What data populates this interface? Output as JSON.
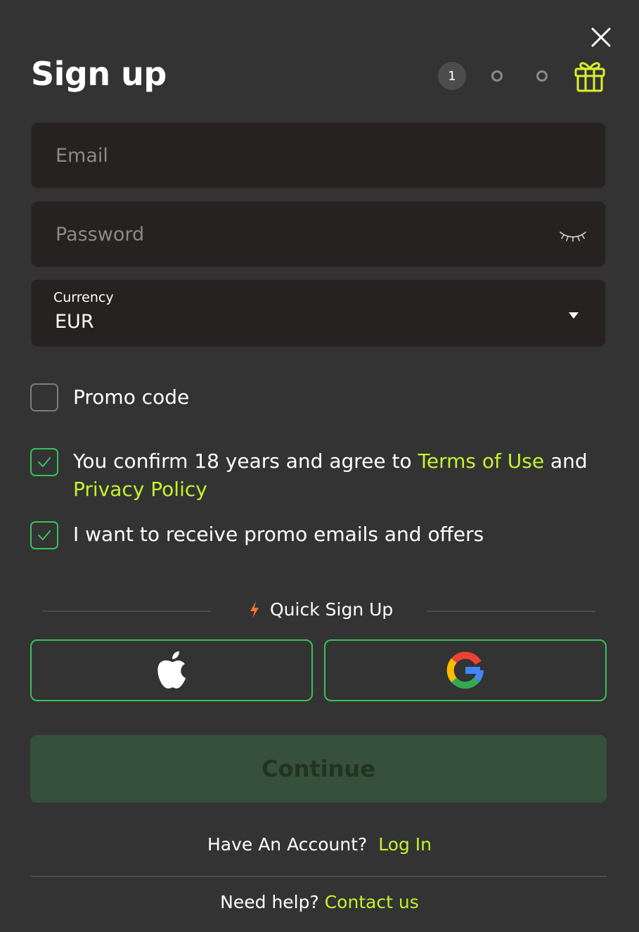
{
  "header": {
    "title": "Sign up",
    "current_step": "1",
    "steps_total": 3
  },
  "form": {
    "email_placeholder": "Email",
    "password_placeholder": "Password",
    "currency_label": "Currency",
    "currency_value": "EUR"
  },
  "checkboxes": {
    "promo_code": {
      "label": "Promo code",
      "checked": false
    },
    "terms": {
      "prefix": "You confirm 18 years and agree to ",
      "terms_link": "Terms of Use",
      "middle": " and ",
      "privacy_link": "Privacy Policy",
      "checked": true
    },
    "promo_emails": {
      "label": "I want to receive promo emails and offers",
      "checked": true
    }
  },
  "quick_signup": {
    "label": "Quick Sign Up"
  },
  "continue_label": "Continue",
  "footer": {
    "account_prompt": "Have An Account?",
    "login_link": "Log In",
    "help_prompt": "Need help?",
    "contact_link": "Contact us"
  },
  "colors": {
    "background": "#333333",
    "field_bg": "#262222",
    "accent_link": "#c4f231",
    "accent_green": "#39c15a",
    "continue_bg": "#35503b",
    "gift": "#d6f22a",
    "bolt": "#f5703a"
  },
  "icons": {
    "close": "close-icon",
    "gift": "gift-icon",
    "password_toggle": "eye-closed-icon",
    "dropdown": "chevron-down-icon",
    "bolt": "bolt-icon",
    "apple": "apple-icon",
    "google": "google-icon"
  }
}
